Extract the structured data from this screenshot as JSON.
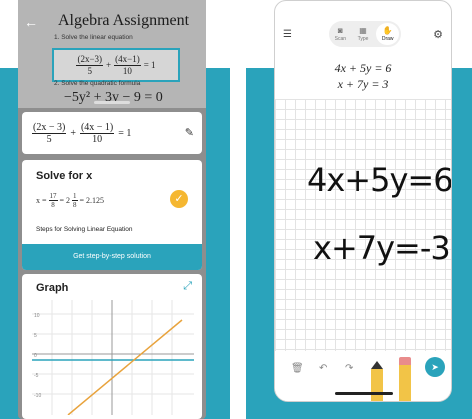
{
  "left_phone": {
    "photo": {
      "title": "Algebra Assignment",
      "step1": "1. Solve the linear equation",
      "step2": "2. Solve the quadratic formula",
      "equation_parts": [
        "(2x−3)",
        "5",
        "+",
        "(4x−1)",
        "10",
        "= 1"
      ],
      "equation2": "−5y² + 3y − 9 = 0"
    },
    "input_equation": {
      "num1": "(2x − 3)",
      "den1": "5",
      "plus": "+",
      "num2": "(4x − 1)",
      "den2": "10",
      "rhs": "= 1"
    },
    "solve": {
      "title": "Solve for x",
      "lhs": "x =",
      "n1": "17",
      "d1": "8",
      "mid": "= 2",
      "n2": "1",
      "d2": "8",
      "rhs": "= 2.125",
      "steps_label": "Steps for Solving Linear Equation",
      "button_label": "Get step-by-step solution"
    },
    "graph": {
      "title": "Graph",
      "y_ticks": [
        "10",
        "5",
        "0",
        "-5",
        "-10"
      ]
    }
  },
  "right_phone": {
    "modes": [
      {
        "label": "Scan",
        "icon": "camera-icon"
      },
      {
        "label": "Type",
        "icon": "keyboard-icon"
      },
      {
        "label": "Draw",
        "icon": "hand-icon"
      }
    ],
    "typed_equations": [
      "4x + 5y = 6",
      "x + 7y = 3"
    ],
    "handwritten": [
      "4x+5y=6",
      "x+7y=-3"
    ]
  },
  "colors": {
    "accent": "#2aa3bb",
    "check": "#f5b731",
    "graph_line": "#e8a33d"
  }
}
